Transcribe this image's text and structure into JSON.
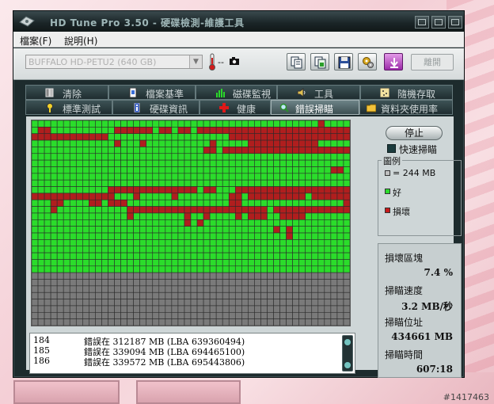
{
  "window": {
    "title": "HD Tune Pro 3.50 - 硬碟檢測-維護工具"
  },
  "menu": {
    "items": [
      "檔案(F)",
      "說明(H)"
    ]
  },
  "toolbar": {
    "drive": "BUFFALO HD-PETU2 (640 GB)",
    "temperature": "--",
    "exit_label": "離開"
  },
  "tabs": {
    "row1": [
      {
        "label": "清除",
        "icon": "eraser-icon"
      },
      {
        "label": "檔案基準",
        "icon": "file-benchmark-icon"
      },
      {
        "label": "磁碟監視",
        "icon": "disk-monitor-icon"
      },
      {
        "label": "工具",
        "icon": "speaker-icon"
      },
      {
        "label": "隨機存取",
        "icon": "random-access-icon"
      }
    ],
    "row2": [
      {
        "label": "標準測試",
        "icon": "benchmark-icon"
      },
      {
        "label": "硬碟資訊",
        "icon": "info-icon"
      },
      {
        "label": "健康",
        "icon": "health-cross-icon"
      },
      {
        "label": "錯誤掃瞄",
        "icon": "magnifier-icon"
      },
      {
        "label": "資料夾使用率",
        "icon": "folder-icon"
      }
    ],
    "active": "錯誤掃瞄"
  },
  "scan_grid": {
    "columns": 50,
    "rows": 31,
    "scanned_rows": 23,
    "colors": {
      "ok": "#2bdc2b",
      "bad": "#b01e1e",
      "pending": "#7a7a7a",
      "line": "#2b2b2b"
    },
    "bad_blocks": [
      [
        0,
        45
      ],
      [
        1,
        1
      ],
      [
        1,
        2
      ],
      [
        1,
        13
      ],
      [
        1,
        14
      ],
      [
        1,
        15
      ],
      [
        1,
        16
      ],
      [
        1,
        17
      ],
      [
        1,
        18
      ],
      [
        1,
        20
      ],
      [
        1,
        21
      ],
      [
        1,
        23
      ],
      [
        1,
        24
      ],
      [
        1,
        26
      ],
      [
        1,
        27
      ],
      [
        1,
        28
      ],
      [
        1,
        29
      ],
      [
        1,
        30
      ],
      [
        1,
        31
      ],
      [
        1,
        32
      ],
      [
        1,
        33
      ],
      [
        1,
        34
      ],
      [
        1,
        35
      ],
      [
        1,
        36
      ],
      [
        1,
        37
      ],
      [
        1,
        38
      ],
      [
        1,
        39
      ],
      [
        1,
        40
      ],
      [
        1,
        41
      ],
      [
        1,
        42
      ],
      [
        1,
        43
      ],
      [
        1,
        44
      ],
      [
        1,
        45
      ],
      [
        1,
        46
      ],
      [
        1,
        47
      ],
      [
        1,
        48
      ],
      [
        1,
        49
      ],
      [
        2,
        0
      ],
      [
        2,
        1
      ],
      [
        2,
        2
      ],
      [
        2,
        3
      ],
      [
        2,
        4
      ],
      [
        2,
        5
      ],
      [
        2,
        6
      ],
      [
        2,
        7
      ],
      [
        2,
        8
      ],
      [
        2,
        9
      ],
      [
        2,
        10
      ],
      [
        2,
        11
      ],
      [
        2,
        31
      ],
      [
        2,
        32
      ],
      [
        2,
        33
      ],
      [
        2,
        34
      ],
      [
        2,
        35
      ],
      [
        2,
        36
      ],
      [
        2,
        37
      ],
      [
        2,
        38
      ],
      [
        2,
        39
      ],
      [
        2,
        40
      ],
      [
        2,
        41
      ],
      [
        2,
        42
      ],
      [
        2,
        43
      ],
      [
        2,
        44
      ],
      [
        2,
        45
      ],
      [
        2,
        46
      ],
      [
        2,
        47
      ],
      [
        2,
        48
      ],
      [
        2,
        49
      ],
      [
        3,
        13
      ],
      [
        3,
        17
      ],
      [
        3,
        28
      ],
      [
        3,
        34
      ],
      [
        3,
        35
      ],
      [
        3,
        36
      ],
      [
        3,
        37
      ],
      [
        3,
        38
      ],
      [
        3,
        39
      ],
      [
        3,
        40
      ],
      [
        3,
        41
      ],
      [
        3,
        42
      ],
      [
        3,
        43
      ],
      [
        3,
        44
      ],
      [
        4,
        27
      ],
      [
        4,
        28
      ],
      [
        4,
        30
      ],
      [
        4,
        31
      ],
      [
        4,
        32
      ],
      [
        4,
        33
      ],
      [
        4,
        34
      ],
      [
        4,
        35
      ],
      [
        4,
        36
      ],
      [
        4,
        37
      ],
      [
        4,
        38
      ],
      [
        4,
        39
      ],
      [
        4,
        40
      ],
      [
        4,
        41
      ],
      [
        4,
        42
      ],
      [
        4,
        43
      ],
      [
        4,
        44
      ],
      [
        4,
        45
      ],
      [
        4,
        46
      ],
      [
        4,
        47
      ],
      [
        4,
        48
      ],
      [
        4,
        49
      ],
      [
        7,
        47
      ],
      [
        7,
        48
      ],
      [
        10,
        12
      ],
      [
        10,
        13
      ],
      [
        10,
        14
      ],
      [
        10,
        15
      ],
      [
        10,
        16
      ],
      [
        10,
        17
      ],
      [
        10,
        18
      ],
      [
        10,
        19
      ],
      [
        10,
        20
      ],
      [
        10,
        21
      ],
      [
        10,
        22
      ],
      [
        10,
        23
      ],
      [
        10,
        24
      ],
      [
        10,
        25
      ],
      [
        10,
        27
      ],
      [
        10,
        28
      ],
      [
        10,
        32
      ],
      [
        10,
        33
      ],
      [
        10,
        34
      ],
      [
        10,
        35
      ],
      [
        10,
        36
      ],
      [
        10,
        37
      ],
      [
        10,
        38
      ],
      [
        10,
        39
      ],
      [
        10,
        40
      ],
      [
        10,
        41
      ],
      [
        10,
        42
      ],
      [
        10,
        43
      ],
      [
        10,
        44
      ],
      [
        10,
        45
      ],
      [
        10,
        46
      ],
      [
        10,
        47
      ],
      [
        10,
        48
      ],
      [
        10,
        49
      ],
      [
        11,
        0
      ],
      [
        11,
        1
      ],
      [
        11,
        2
      ],
      [
        11,
        3
      ],
      [
        11,
        4
      ],
      [
        11,
        5
      ],
      [
        11,
        6
      ],
      [
        11,
        7
      ],
      [
        11,
        8
      ],
      [
        11,
        9
      ],
      [
        11,
        10
      ],
      [
        11,
        11
      ],
      [
        11,
        12
      ],
      [
        11,
        16
      ],
      [
        11,
        22
      ],
      [
        11,
        31
      ],
      [
        11,
        32
      ],
      [
        11,
        34
      ],
      [
        11,
        35
      ],
      [
        11,
        36
      ],
      [
        11,
        37
      ],
      [
        11,
        38
      ],
      [
        11,
        39
      ],
      [
        11,
        40
      ],
      [
        11,
        41
      ],
      [
        11,
        42
      ],
      [
        11,
        44
      ],
      [
        11,
        45
      ],
      [
        11,
        46
      ],
      [
        11,
        47
      ],
      [
        11,
        48
      ],
      [
        11,
        49
      ],
      [
        12,
        3
      ],
      [
        12,
        4
      ],
      [
        12,
        9
      ],
      [
        12,
        10
      ],
      [
        12,
        12
      ],
      [
        12,
        13
      ],
      [
        12,
        14
      ],
      [
        12,
        31
      ],
      [
        12,
        32
      ],
      [
        12,
        49
      ],
      [
        13,
        3
      ],
      [
        13,
        15
      ],
      [
        13,
        16
      ],
      [
        13,
        17
      ],
      [
        13,
        18
      ],
      [
        13,
        19
      ],
      [
        13,
        20
      ],
      [
        13,
        21
      ],
      [
        13,
        22
      ],
      [
        13,
        23
      ],
      [
        13,
        24
      ],
      [
        13,
        25
      ],
      [
        13,
        26
      ],
      [
        13,
        27
      ],
      [
        13,
        28
      ],
      [
        13,
        29
      ],
      [
        13,
        30
      ],
      [
        13,
        31
      ],
      [
        13,
        32
      ],
      [
        13,
        33
      ],
      [
        13,
        34
      ],
      [
        13,
        35
      ],
      [
        13,
        36
      ],
      [
        13,
        38
      ],
      [
        13,
        39
      ],
      [
        13,
        40
      ],
      [
        13,
        41
      ],
      [
        13,
        42
      ],
      [
        13,
        43
      ],
      [
        13,
        44
      ],
      [
        13,
        45
      ],
      [
        13,
        46
      ],
      [
        13,
        47
      ],
      [
        13,
        48
      ],
      [
        13,
        49
      ],
      [
        14,
        15
      ],
      [
        14,
        24
      ],
      [
        14,
        27
      ],
      [
        14,
        32
      ],
      [
        14,
        34
      ],
      [
        14,
        35
      ],
      [
        14,
        36
      ],
      [
        14,
        39
      ],
      [
        14,
        40
      ],
      [
        14,
        41
      ],
      [
        14,
        42
      ],
      [
        15,
        24
      ],
      [
        15,
        26
      ],
      [
        16,
        38
      ],
      [
        16,
        40
      ],
      [
        17,
        40
      ]
    ]
  },
  "log": [
    {
      "num": "184",
      "msg": "錯誤在 312187 MB (LBA 639360494)"
    },
    {
      "num": "185",
      "msg": "錯誤在 339094 MB (LBA 694465100)"
    },
    {
      "num": "186",
      "msg": "錯誤在 339572 MB (LBA 695443806)"
    }
  ],
  "side": {
    "stop_label": "停止",
    "quick_scan_label": "快速掃瞄",
    "legend_title": "圖例",
    "legend_block": "= 244 MB",
    "legend_ok": "好",
    "legend_bad": "損壞",
    "damaged_label": "損壞區塊",
    "damaged_value": "7.4 %",
    "speed_label": "掃瞄速度",
    "speed_value": "3.2 MB/秒",
    "position_label": "掃瞄位址",
    "position_value": "434661 MB",
    "time_label": "掃瞄時間",
    "time_value": "607:18"
  },
  "watermark": "#1417463"
}
